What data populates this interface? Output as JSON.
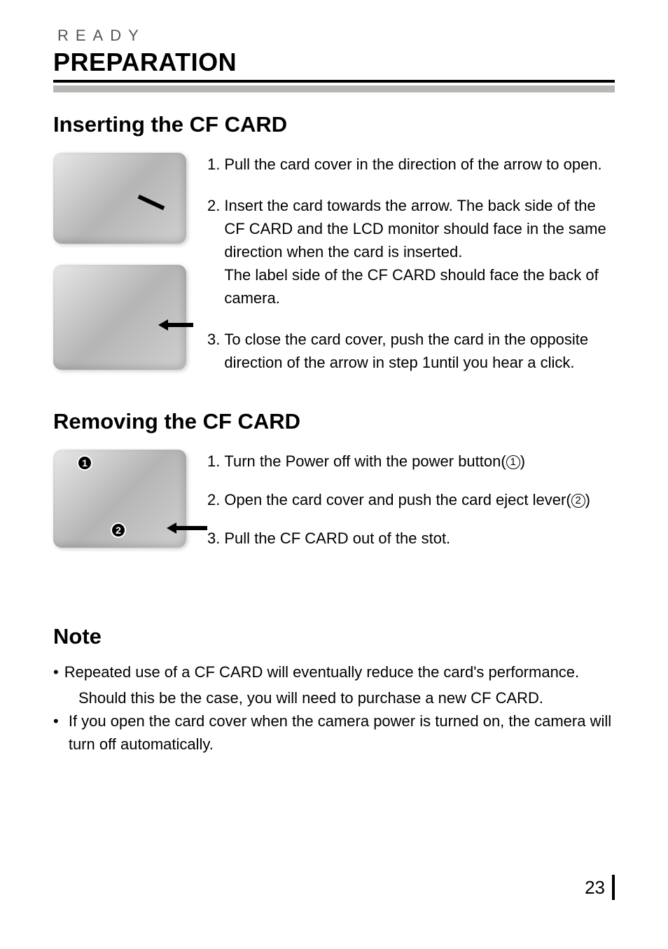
{
  "header": {
    "breadcrumb": "READY",
    "title": "PREPARATION"
  },
  "section1": {
    "heading": "Inserting the CF CARD",
    "steps": [
      {
        "num": "1.",
        "text": "Pull the card cover in the direction of the arrow to open."
      },
      {
        "num": "2.",
        "text": "Insert the card towards the arrow. The back side of the CF CARD and the LCD monitor should face in the same direction when the card is inserted.\nThe label side of the CF CARD should face the back of camera."
      },
      {
        "num": "3.",
        "text": "To close the card cover, push the card in the opposite direction of the arrow in step 1until you hear a click."
      }
    ]
  },
  "section2": {
    "heading": "Removing the CF CARD",
    "steps": [
      {
        "num": "1.",
        "text_a": "Turn the Power off with the power button(",
        "circ": "1",
        "text_b": ")"
      },
      {
        "num": "2.",
        "text_a": "Open the card cover and push the card eject lever(",
        "circ": "2",
        "text_b": ")"
      },
      {
        "num": "3.",
        "text_a": "Pull the CF CARD out of the stot.",
        "circ": "",
        "text_b": ""
      }
    ],
    "callouts": {
      "one": "1",
      "two": "2"
    }
  },
  "note": {
    "heading": "Note",
    "items": [
      {
        "line1": "Repeated use of a CF CARD will eventually reduce the card's performance.",
        "line2": "Should this be the case, you will need to purchase a new CF CARD."
      },
      {
        "line1": "If you open the card cover when the camera power is turned on, the camera will turn off automatically.",
        "line2": ""
      }
    ]
  },
  "page_number": "23"
}
